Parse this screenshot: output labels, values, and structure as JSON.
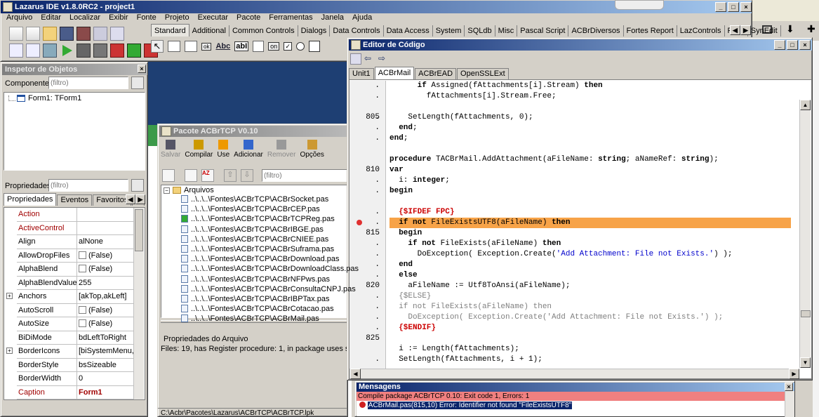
{
  "main": {
    "title": "Lazarus IDE v1.8.0RC2 - project1",
    "menu": [
      "Arquivo",
      "Editar",
      "Localizar",
      "Exibir",
      "Fonte",
      "Projeto",
      "Executar",
      "Pacote",
      "Ferramentas",
      "Janela",
      "Ajuda"
    ],
    "palette_tabs": [
      "Standard",
      "Additional",
      "Common Controls",
      "Dialogs",
      "Data Controls",
      "Data Access",
      "System",
      "SQLdb",
      "Misc",
      "Pascal Script",
      "ACBrDiversos",
      "Fortes Report",
      "LazControls",
      "RTTI",
      "SynEdit"
    ],
    "palette_selected": "Standard",
    "palette_labels": {
      "ok": "ok",
      "abc": "Abc",
      "abl": "abI",
      "on": "on"
    }
  },
  "inspector": {
    "title": "Inspetor de Objetos",
    "components_label": "Componentes",
    "components_filter": "(filtro)",
    "tree_item": "Form1: TForm1",
    "props_label": "Propriedades",
    "props_filter": "(filtro)",
    "tabs": [
      "Propriedades",
      "Eventos",
      "Favoritos",
      "R"
    ],
    "props": [
      {
        "name": "Action",
        "value": "",
        "red": true
      },
      {
        "name": "ActiveControl",
        "value": "",
        "red": true
      },
      {
        "name": "Align",
        "value": "alNone"
      },
      {
        "name": "AllowDropFiles",
        "value": "(False)",
        "check": true
      },
      {
        "name": "AlphaBlend",
        "value": "(False)",
        "check": true
      },
      {
        "name": "AlphaBlendValue",
        "value": "255"
      },
      {
        "name": "Anchors",
        "value": "[akTop,akLeft]",
        "plus": true
      },
      {
        "name": "AutoScroll",
        "value": "(False)",
        "check": true
      },
      {
        "name": "AutoSize",
        "value": "(False)",
        "check": true
      },
      {
        "name": "BiDiMode",
        "value": "bdLeftToRight"
      },
      {
        "name": "BorderIcons",
        "value": "[biSystemMenu,biM",
        "plus": true
      },
      {
        "name": "BorderStyle",
        "value": "bsSizeable"
      },
      {
        "name": "BorderWidth",
        "value": "0"
      },
      {
        "name": "Caption",
        "value": "Form1",
        "red": true,
        "bold": true
      }
    ]
  },
  "package": {
    "title": "Pacote ACBrTCP V0.10",
    "toolbar": [
      "Salvar",
      "Compilar",
      "Use",
      "Adicionar",
      "Remover",
      "Opções"
    ],
    "filter": "(filtro)",
    "files_label": "Arquivos",
    "files": [
      "..\\..\\..\\Fontes\\ACBrTCP\\ACBrSocket.pas",
      "..\\..\\..\\Fontes\\ACBrTCP\\ACBrCEP.pas",
      "..\\..\\..\\Fontes\\ACBrTCP\\ACBrTCPReg.pas",
      "..\\..\\..\\Fontes\\ACBrTCP\\ACBrIBGE.pas",
      "..\\..\\..\\Fontes\\ACBrTCP\\ACBrCNIEE.pas",
      "..\\..\\..\\Fontes\\ACBrTCP\\ACBrSuframa.pas",
      "..\\..\\..\\Fontes\\ACBrTCP\\ACBrDownload.pas",
      "..\\..\\..\\Fontes\\ACBrTCP\\ACBrDownloadClass.pas",
      "..\\..\\..\\Fontes\\ACBrTCP\\ACBrNFPws.pas",
      "..\\..\\..\\Fontes\\ACBrTCP\\ACBrConsultaCNPJ.pas",
      "..\\..\\..\\Fontes\\ACBrTCP\\ACBrIBPTax.pas",
      "..\\..\\..\\Fontes\\ACBrTCP\\ACBrCotacao.pas",
      "..\\..\\..\\Fontes\\ACBrTCP\\ACBrMail.pas"
    ],
    "props_label": "Propriedades do Arquivo",
    "info": "Files: 19, has Register procedure: 1, in package uses section:",
    "path": "C:\\Acbr\\Pacotes\\Lazarus\\ACBrTCP\\ACBrTCP.lpk"
  },
  "editor": {
    "title": "Editor de Código",
    "tabs": [
      "Unit1",
      "ACBrMail",
      "ACBrEAD",
      "OpenSSLExt"
    ],
    "tab_selected": "ACBrMail",
    "gutter": [
      ".",
      ".",
      "",
      ".",
      ".",
      ".",
      "",
      "",
      "810",
      ".",
      ".",
      "",
      ".",
      ".",
      "815",
      ".",
      ".",
      ".",
      ".",
      "820",
      ".",
      ".",
      ".",
      ".",
      "825",
      "",
      "."
    ],
    "lines": [
      "      if Assigned(fAttachments[i].Stream) then",
      "        fAttachments[i].Stream.Free;",
      "",
      "    SetLength(fAttachments, 0);",
      "  end;",
      "end;",
      "",
      "procedure TACBrMail.AddAttachment(aFileName: string; aNameRef: string);",
      "var",
      "  i: integer;",
      "begin",
      "",
      "  {$IFDEF FPC}",
      "  if not FileExistsUTF8(aFileName) then",
      "  begin",
      "    if not FileExists(aFileName) then",
      "      DoException( Exception.Create('Add Attachment: File not Exists.') );",
      "  end",
      "  else",
      "    aFileName := Utf8ToAnsi(aFileName);",
      "  {$ELSE}",
      "  if not FileExists(aFileName) then",
      "    DoException( Exception.Create('Add Attachment: File not Exists.') );",
      "  {$ENDIF}",
      "",
      "  i := Length(fAttachments);",
      "  SetLength(fAttachments, i + 1);"
    ],
    "line_805": "805"
  },
  "messages": {
    "title": "Mensagens",
    "compile": "Compile package ACBrTCP 0.10: Exit code 1, Errors: 1",
    "error": "ACBrMail.pas(815,10) Error: Identifier not found \"FileExistsUTF8\""
  },
  "colors": {
    "highlight": "#f7a348",
    "error_bar": "#f08080",
    "title_active": "#0a246a"
  }
}
